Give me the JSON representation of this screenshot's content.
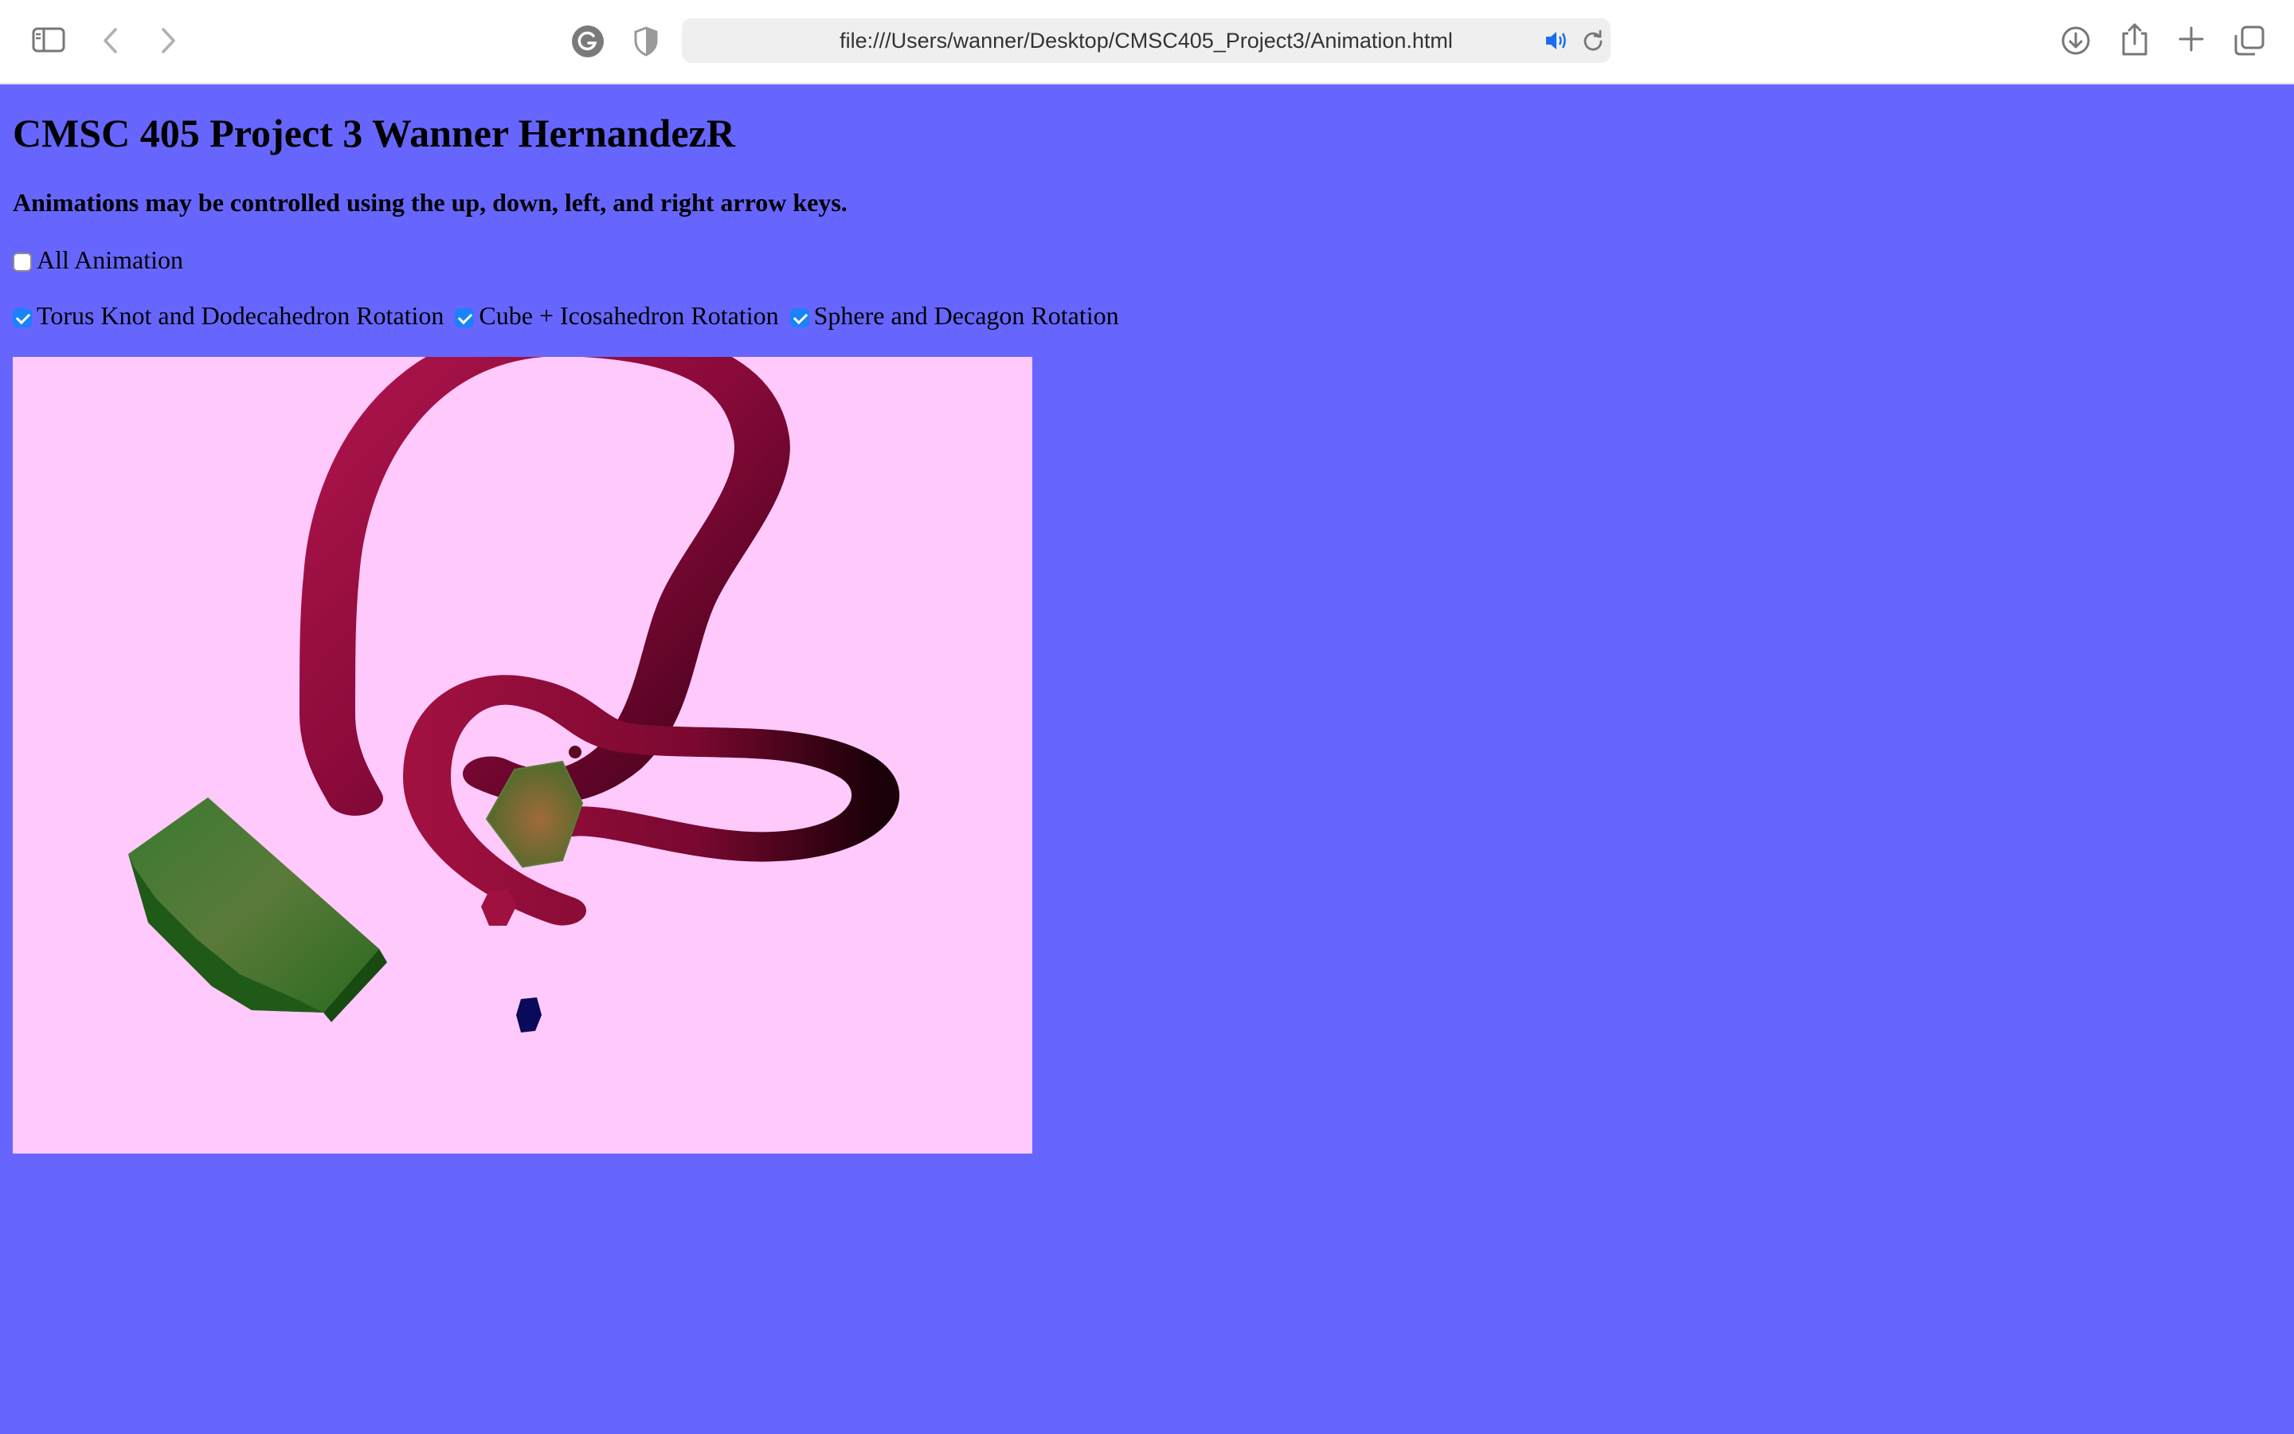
{
  "browser": {
    "url": "file:///Users/wanner/Desktop/CMSC405_Project3/Animation.html",
    "icons": {
      "sidebar": "sidebar-icon",
      "back": "back-icon",
      "forward": "forward-icon",
      "extension": "grammarly-icon",
      "privacy": "shield-icon",
      "audio": "speaker-icon",
      "reload": "reload-icon",
      "downloads": "download-icon",
      "share": "share-icon",
      "new_tab": "plus-icon",
      "tabs": "tab-overview-icon"
    }
  },
  "page": {
    "title": "CMSC 405 Project 3 Wanner HernandezR",
    "instructions": "Animations may be controlled using the up, down, left, and right arrow keys.",
    "all_animation": {
      "label": "All Animation",
      "checked": false
    },
    "toggles": [
      {
        "label": "Torus Knot and Dodecahedron Rotation",
        "checked": true
      },
      {
        "label": "Cube + Icosahedron Rotation",
        "checked": true
      },
      {
        "label": "Sphere and Decagon Rotation",
        "checked": true
      }
    ]
  },
  "colors": {
    "page_background": "#6666ff",
    "canvas_background": "#ffc9fb",
    "checkbox_accent": "#1a82fb",
    "torus_knot": "#8a0a3a",
    "decagon": "#2b6a22",
    "dodecahedron": "#7a6a3a",
    "small_red_shape": "#a01040",
    "small_blue_shape": "#0a0a5a"
  }
}
